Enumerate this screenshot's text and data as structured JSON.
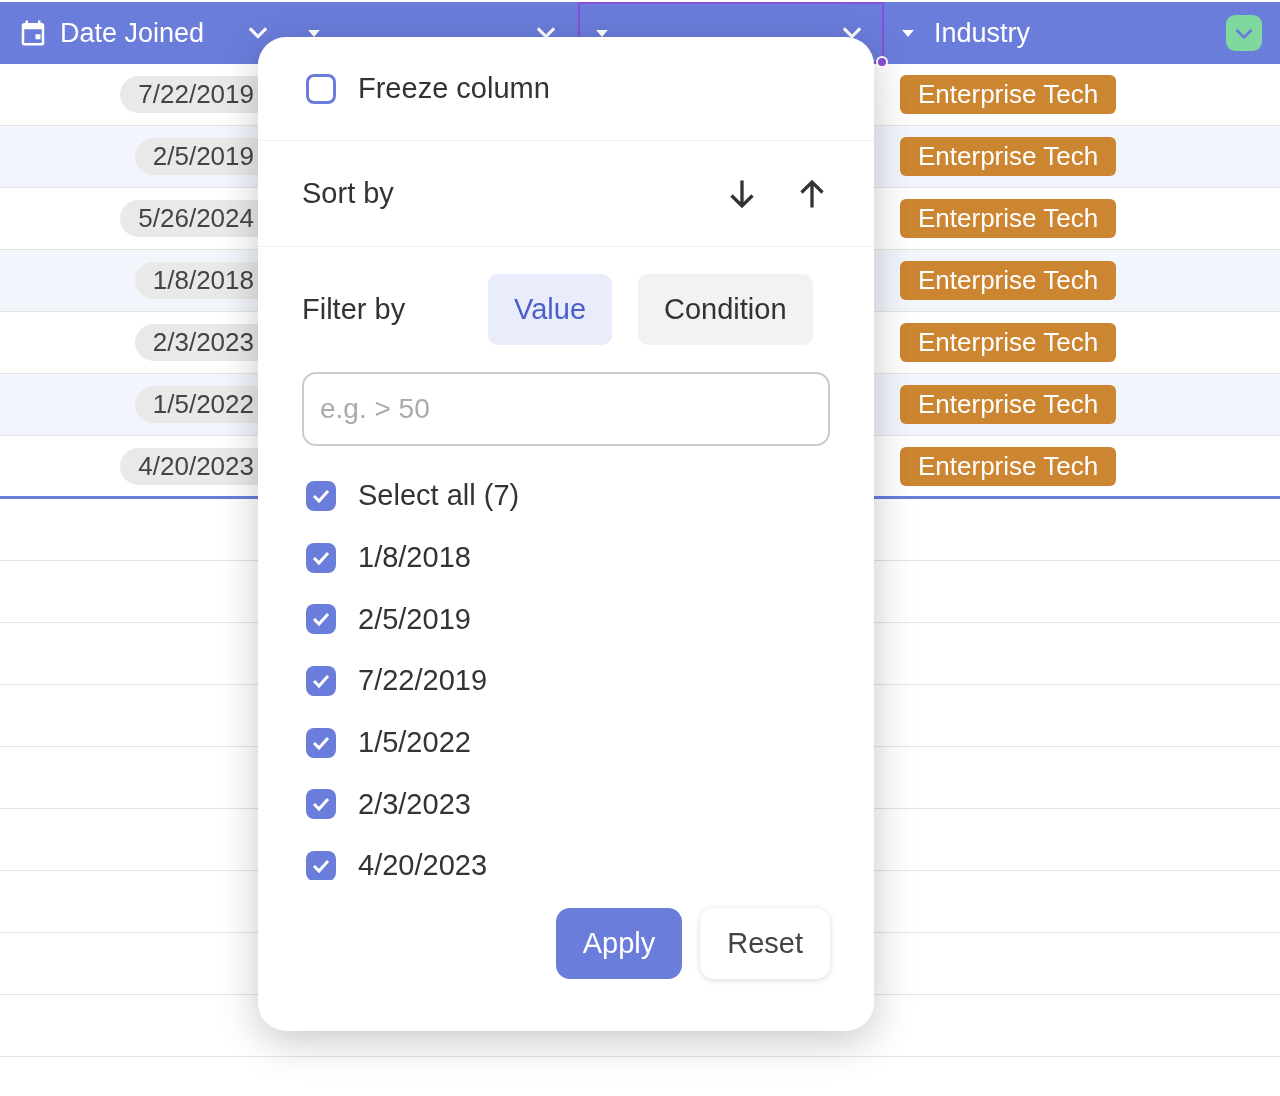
{
  "columns": [
    {
      "label": "Date Joined",
      "kind": "date",
      "selected": false
    },
    {
      "kind": "text",
      "selected": false
    },
    {
      "kind": "text",
      "selected": true
    },
    {
      "label": "Industry",
      "kind": "text",
      "selected": false
    }
  ],
  "rows": [
    {
      "date": "7/22/2019",
      "industry": "Enterprise Tech"
    },
    {
      "date": "2/5/2019",
      "industry": "Enterprise Tech"
    },
    {
      "date": "5/26/2024",
      "industry": "Enterprise Tech"
    },
    {
      "date": "1/8/2018",
      "industry": "Enterprise Tech"
    },
    {
      "date": "2/3/2023",
      "industry": "Enterprise Tech"
    },
    {
      "date": "1/5/2022",
      "industry": "Enterprise Tech"
    },
    {
      "date": "4/20/2023",
      "industry": "Enterprise Tech"
    }
  ],
  "menu": {
    "freeze": {
      "label": "Freeze column",
      "checked": false
    },
    "sort_label": "Sort by",
    "filter_label": "Filter by",
    "filter_tabs": [
      {
        "label": "Value",
        "selected": true
      },
      {
        "label": "Condition",
        "selected": false
      }
    ],
    "search": {
      "placeholder": "e.g. > 50"
    },
    "options": [
      {
        "label": "Select all (7)",
        "checked": true
      },
      {
        "label": "1/8/2018",
        "checked": true
      },
      {
        "label": "2/5/2019",
        "checked": true
      },
      {
        "label": "7/22/2019",
        "checked": true
      },
      {
        "label": "1/5/2022",
        "checked": true
      },
      {
        "label": "2/3/2023",
        "checked": true
      },
      {
        "label": "4/20/2023",
        "checked": true
      }
    ],
    "buttons": [
      {
        "label": "Apply",
        "kind": "primary"
      },
      {
        "label": "Reset",
        "kind": "secondary"
      }
    ]
  }
}
